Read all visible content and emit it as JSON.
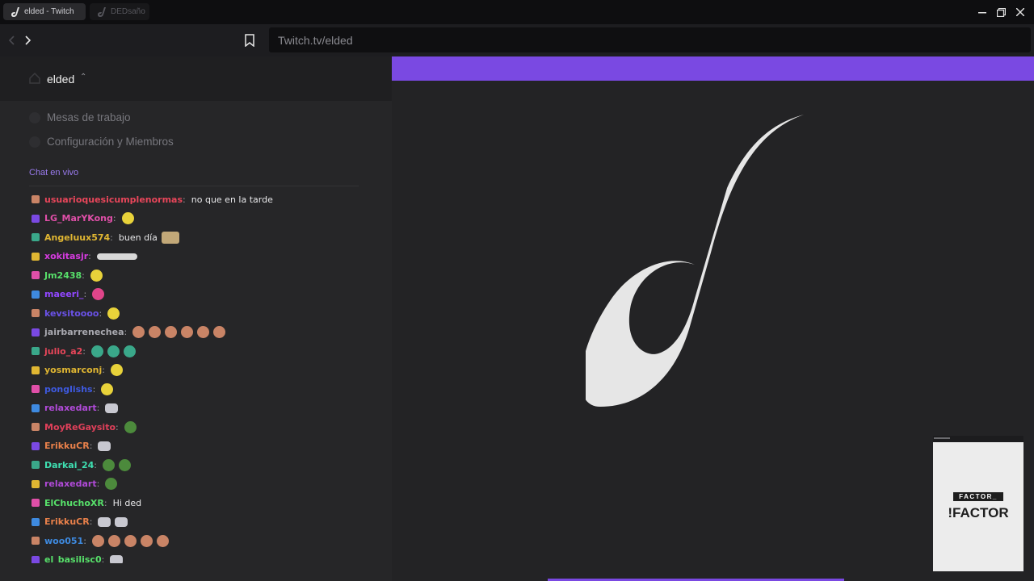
{
  "tabs": [
    {
      "label": "elded - Twitch",
      "active": true,
      "icon": "elded-logo-icon"
    },
    {
      "label": "DEDsaño",
      "active": false,
      "icon": "elded-logo-icon"
    }
  ],
  "window_controls": [
    "minimize-icon",
    "restore-icon",
    "close-icon"
  ],
  "address_bar": {
    "url": "Twitch.tv/elded",
    "icons": [
      "back-icon",
      "forward-icon",
      "bookmark-icon"
    ]
  },
  "workspace": {
    "name": "elded",
    "icon": "home-icon"
  },
  "menu": [
    {
      "label": "Mesas de trabajo"
    },
    {
      "label": "Configuración y Miembros"
    }
  ],
  "chat": {
    "title": "Chat en vivo",
    "messages": [
      {
        "user": "usuarioquesicumplenormas",
        "color": "#e8465a",
        "text": "no que en la tarde",
        "emotes": []
      },
      {
        "user": "LG_MarYKong",
        "color": "#e04fa8",
        "text": "",
        "emotes": [
          "y"
        ]
      },
      {
        "user": "Angeluux574",
        "color": "#e0b632",
        "text": "buen día",
        "emotes": [
          "c"
        ]
      },
      {
        "user": "xokitasjr",
        "color": "#d63be0",
        "text": "",
        "emotes": [
          "s"
        ]
      },
      {
        "user": "Jm2438",
        "color": "#57e06a",
        "text": "",
        "emotes": [
          "y"
        ]
      },
      {
        "user": "maeeri_",
        "color": "#9147ff",
        "text": "",
        "emotes": [
          "h"
        ]
      },
      {
        "user": "kevsitoooo",
        "color": "#6a52e8",
        "text": "",
        "emotes": [
          "y"
        ]
      },
      {
        "user": "jairbarrenechea",
        "color": "#a9a9b0",
        "text": "",
        "emotes": [
          "p",
          "p",
          "p",
          "p",
          "p",
          "p"
        ]
      },
      {
        "user": "julio_a2",
        "color": "#e8465a",
        "text": "",
        "emotes": [
          "g",
          "g",
          "g"
        ]
      },
      {
        "user": "yosmarconj",
        "color": "#e0b632",
        "text": "",
        "emotes": [
          "y"
        ]
      },
      {
        "user": "ponglishs",
        "color": "#3e5ae0",
        "text": "",
        "emotes": [
          "y"
        ]
      },
      {
        "user": "relaxedart",
        "color": "#b04ad8",
        "text": "",
        "emotes": [
          "w"
        ]
      },
      {
        "user": "MoyReGaysito",
        "color": "#e0405a",
        "text": "",
        "emotes": [
          "f"
        ]
      },
      {
        "user": "ErikkuCR",
        "color": "#e8804a",
        "text": "",
        "emotes": [
          "w"
        ]
      },
      {
        "user": "Darkai_24",
        "color": "#3ee0b2",
        "text": "",
        "emotes": [
          "f",
          "f"
        ]
      },
      {
        "user": "relaxedart",
        "color": "#b04ad8",
        "text": "",
        "emotes": [
          "f"
        ]
      },
      {
        "user": "ElChuchoXR",
        "color": "#57e06a",
        "text": "Hi ded",
        "emotes": []
      },
      {
        "user": "ErikkuCR",
        "color": "#e8804a",
        "text": "",
        "emotes": [
          "w",
          "w"
        ]
      },
      {
        "user": "woo051",
        "color": "#3e8ae0",
        "text": "",
        "emotes": [
          "p",
          "p",
          "p",
          "p",
          "p"
        ]
      },
      {
        "user": "el_basilisc0",
        "color": "#57e06a",
        "text": "",
        "emotes": [
          "w"
        ]
      }
    ]
  },
  "ad": {
    "small": "FACTOR_",
    "big": "!FACTOR"
  },
  "colors": {
    "accent": "#7a49e2",
    "panel": "#262628",
    "background": "#232325"
  }
}
